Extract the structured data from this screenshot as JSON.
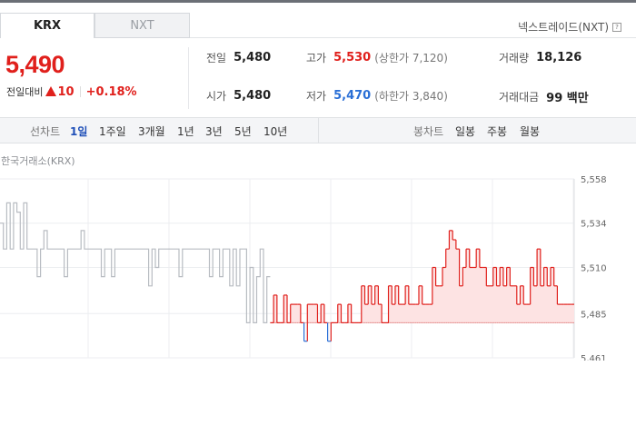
{
  "tabs": {
    "krx": "KRX",
    "nxt": "NXT"
  },
  "nxt_link": "넥스트레이드(NXT)",
  "price": {
    "current": "5,490",
    "change_label": "전일대비",
    "change_value": "10",
    "change_rate": "+0.18%"
  },
  "stats": {
    "prev_close_label": "전일",
    "prev_close": "5,480",
    "high_label": "고가",
    "high": "5,530",
    "upper_limit": "(상한가 7,120)",
    "volume_label": "거래량",
    "volume": "18,126",
    "open_label": "시가",
    "open": "5,480",
    "low_label": "저가",
    "low": "5,470",
    "lower_limit": "(하한가 3,840)",
    "amount_label": "거래대금",
    "amount": "99 백만"
  },
  "periods": {
    "line_label": "선차트",
    "items": [
      "1일",
      "1주일",
      "3개월",
      "1년",
      "3년",
      "5년",
      "10년"
    ],
    "active": "1일",
    "candle_label": "봉차트",
    "candle_items": [
      "일봉",
      "주봉",
      "월봉"
    ]
  },
  "market_label": "한국거래소(KRX)",
  "colors": {
    "up": "#e0201c",
    "down": "#2a6fd6",
    "pre": "#b8bcc2",
    "fill": "#fde3e3"
  },
  "chart_data": {
    "type": "line",
    "title": "",
    "baseline": 5480,
    "ylim": [
      5461,
      5558
    ],
    "yticks": [
      5558,
      5534,
      5510,
      5485,
      5461
    ],
    "pre_market": [
      5534,
      5520,
      5545,
      5520,
      5545,
      5540,
      5520,
      5545,
      5520,
      5520,
      5520,
      5505,
      5520,
      5530,
      5520,
      5520,
      5520,
      5520,
      5520,
      5505,
      5520,
      5520,
      5520,
      5520,
      5530,
      5520,
      5520,
      5520,
      5520,
      5520,
      5505,
      5520,
      5520,
      5505,
      5520,
      5520,
      5520,
      5520,
      5520,
      5520,
      5520,
      5520,
      5520,
      5520,
      5500,
      5520,
      5510,
      5520,
      5520,
      5520,
      5520,
      5520,
      5520,
      5505,
      5520,
      5520,
      5520,
      5520,
      5520,
      5520,
      5520,
      5520,
      5505,
      5520,
      5520,
      5505,
      5520,
      5520,
      5500,
      5520,
      5500,
      5520,
      5520,
      5480,
      5510,
      5480,
      5505,
      5520,
      5480,
      5505
    ],
    "regular": [
      5480,
      5495,
      5480,
      5480,
      5495,
      5480,
      5490,
      5490,
      5490,
      5480,
      5470,
      5490,
      5490,
      5490,
      5480,
      5490,
      5480,
      5470,
      5480,
      5480,
      5490,
      5480,
      5480,
      5490,
      5480,
      5480,
      5480,
      5500,
      5490,
      5500,
      5490,
      5500,
      5490,
      5480,
      5480,
      5500,
      5490,
      5500,
      5490,
      5490,
      5500,
      5490,
      5490,
      5490,
      5500,
      5490,
      5490,
      5490,
      5510,
      5500,
      5500,
      5510,
      5520,
      5530,
      5525,
      5520,
      5500,
      5510,
      5520,
      5510,
      5510,
      5520,
      5510,
      5510,
      5500,
      5500,
      5510,
      5500,
      5510,
      5500,
      5510,
      5500,
      5500,
      5490,
      5500,
      5490,
      5490,
      5510,
      5500,
      5520,
      5500,
      5510,
      5500,
      5510,
      5500,
      5490,
      5490,
      5490,
      5490,
      5490
    ]
  }
}
